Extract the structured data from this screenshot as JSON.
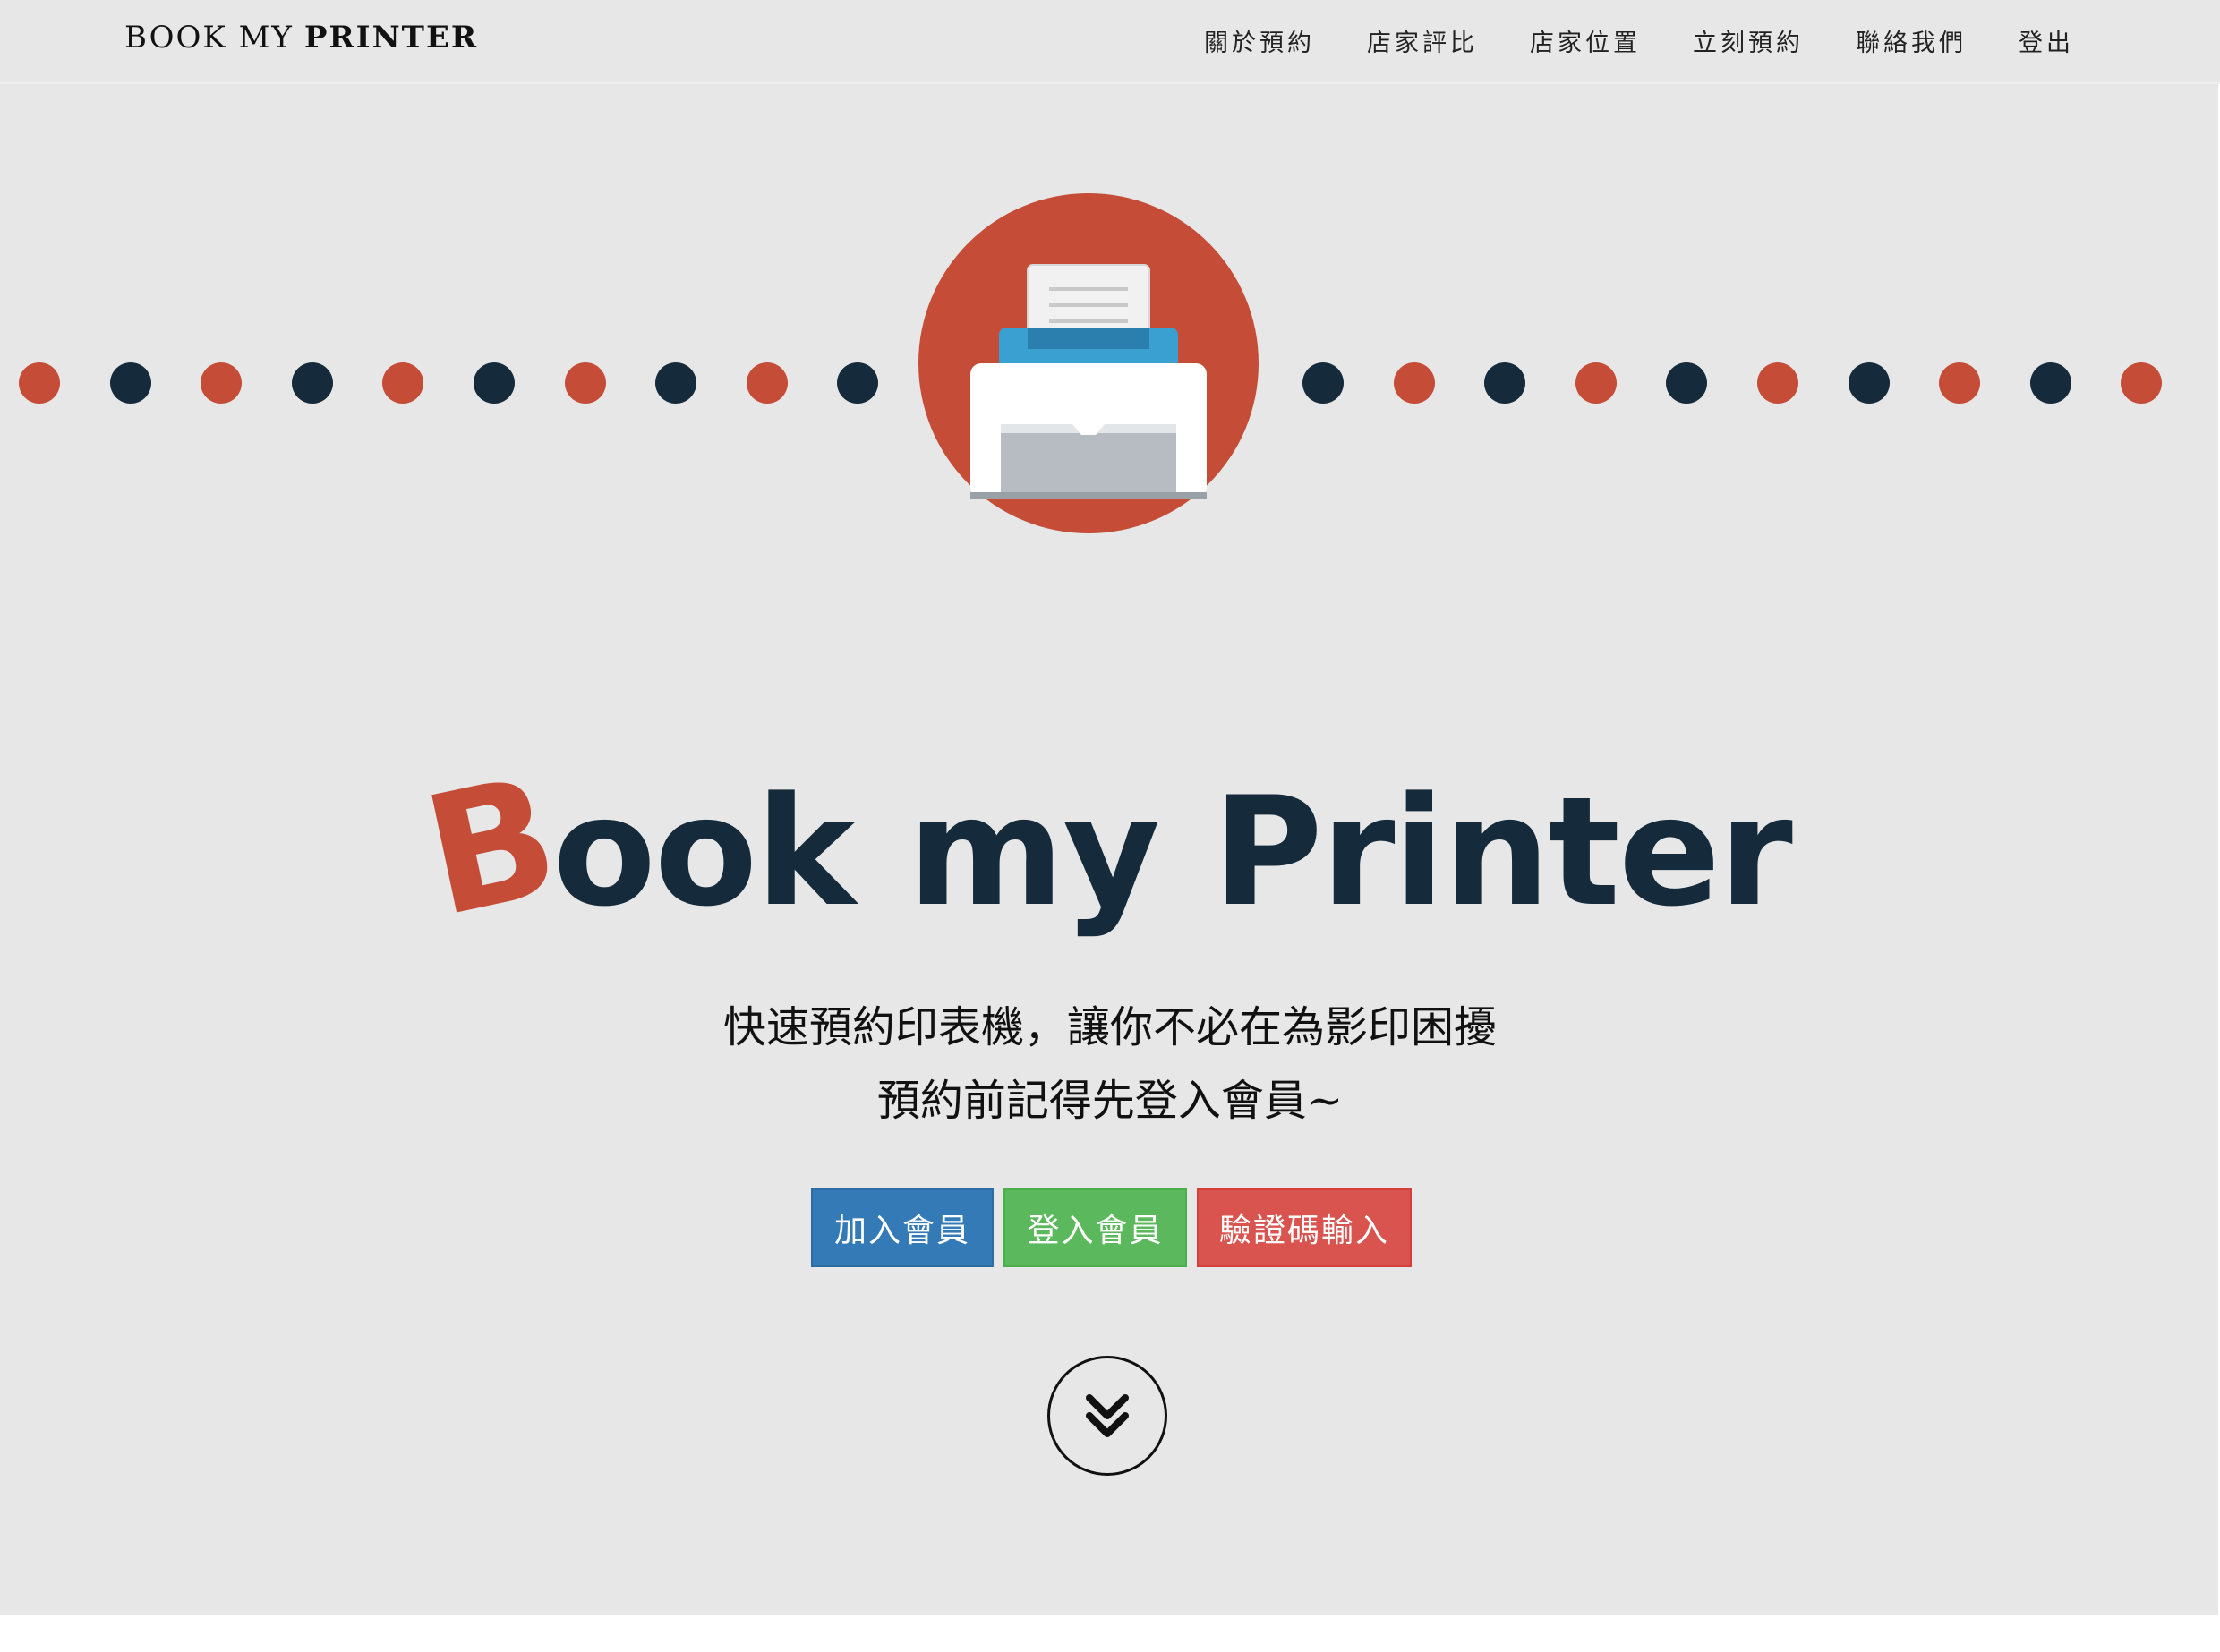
{
  "navbar": {
    "brand_light": "BOOK MY",
    "brand_bold": "PRINTER",
    "links": [
      "關於預約",
      "店家評比",
      "店家位置",
      "立刻預約",
      "聯絡我們",
      "登出"
    ]
  },
  "hero": {
    "logo_icon": "printer-icon",
    "title_first_letter": "B",
    "title_word1_rest": "ook",
    "title_word2": "my",
    "title_word3": "Printer",
    "subtitle_line1": "快速預約印表機，讓你不必在為影印困擾",
    "subtitle_line2": "預約前記得先登入會員~",
    "buttons": {
      "join": "加入會員",
      "login": "登入會員",
      "verify": "驗證碼輸入"
    },
    "scroll_icon": "chevron-double-down-icon"
  },
  "colors": {
    "background": "#e7e7e7",
    "accent_red": "#c54c37",
    "dark_navy": "#152a3a",
    "printer_blue": "#3a9fd1",
    "btn_primary": "#337ab7",
    "btn_success": "#5cb85c",
    "btn_danger": "#d9534f"
  }
}
